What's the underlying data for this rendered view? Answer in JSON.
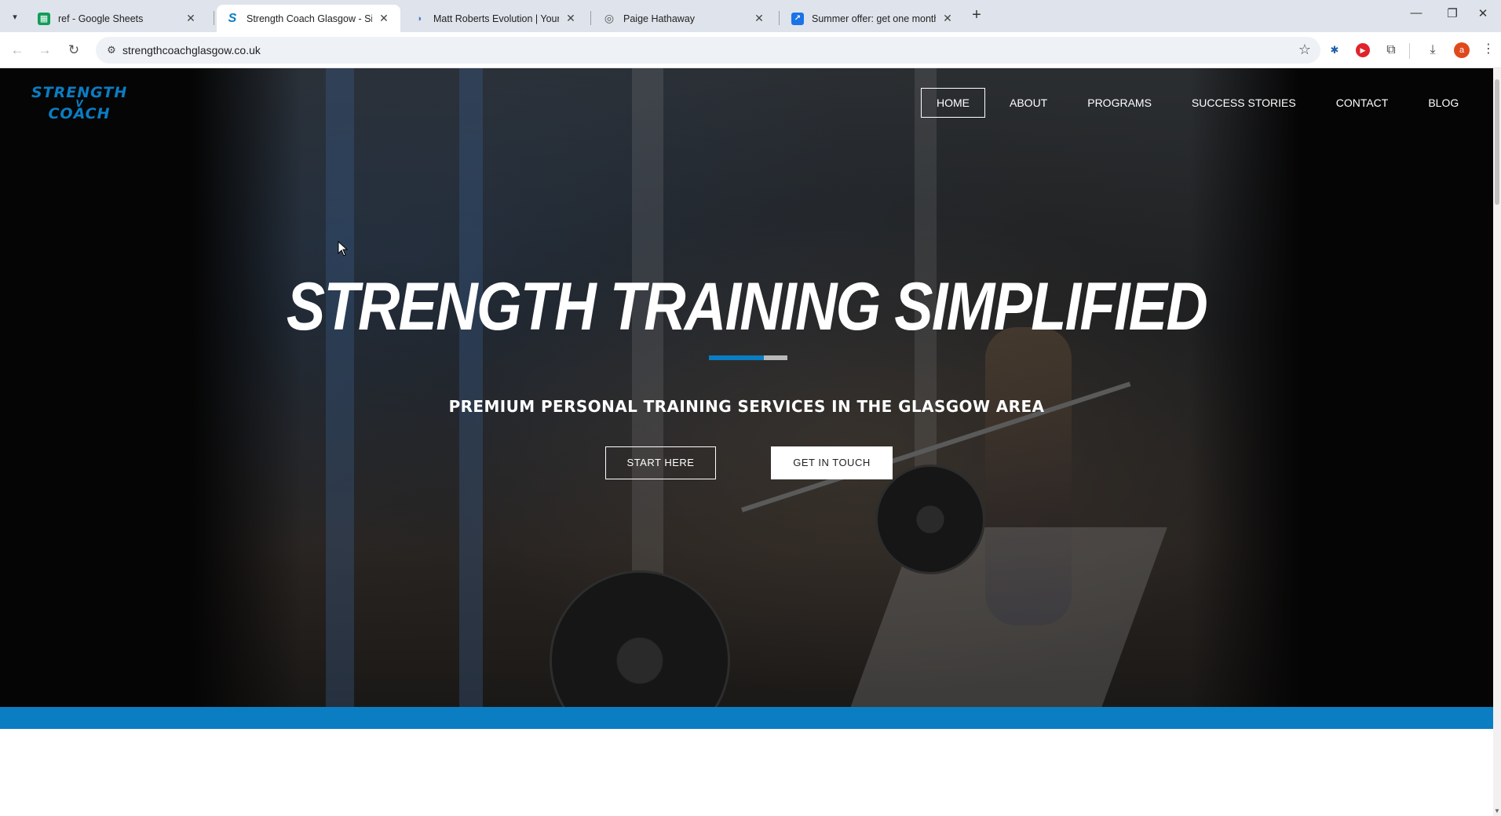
{
  "browser": {
    "tabs": [
      {
        "title": "ref - Google Sheets",
        "icon": "sheets-icon",
        "color": "#0f9d58"
      },
      {
        "title": "Strength Coach Glasgow - Simp",
        "icon": "strength-coach-icon",
        "color": "#0a7dc3"
      },
      {
        "title": "Matt Roberts Evolution | Young",
        "icon": "matt-roberts-icon",
        "color": "#4a7bd0"
      },
      {
        "title": "Paige Hathaway",
        "icon": "globe-icon",
        "color": "#555555"
      },
      {
        "title": "Summer offer: get one month f",
        "icon": "summer-offer-icon",
        "color": "#1a73e8"
      }
    ],
    "url": "strengthcoachglasgow.co.uk",
    "profile_initial": "a"
  },
  "site": {
    "logo": {
      "line1": "STRENGTH",
      "line2": "V",
      "line3": "COACH",
      "color": "#0a7dc3"
    },
    "nav": [
      {
        "label": "HOME",
        "active": true
      },
      {
        "label": "ABOUT",
        "active": false
      },
      {
        "label": "PROGRAMS",
        "active": false
      },
      {
        "label": "SUCCESS STORIES",
        "active": false
      },
      {
        "label": "CONTACT",
        "active": false
      },
      {
        "label": "BLOG",
        "active": false
      }
    ],
    "hero": {
      "title": "STRENGTH TRAINING SIMPLIFIED",
      "subtitle": "PREMIUM PERSONAL TRAINING SERVICES IN THE GLASGOW AREA",
      "buttons": {
        "start": "START HERE",
        "contact": "GET IN TOUCH"
      }
    },
    "colors": {
      "accent": "#0a7dc3",
      "accent_secondary": "#b9b9b9"
    }
  }
}
